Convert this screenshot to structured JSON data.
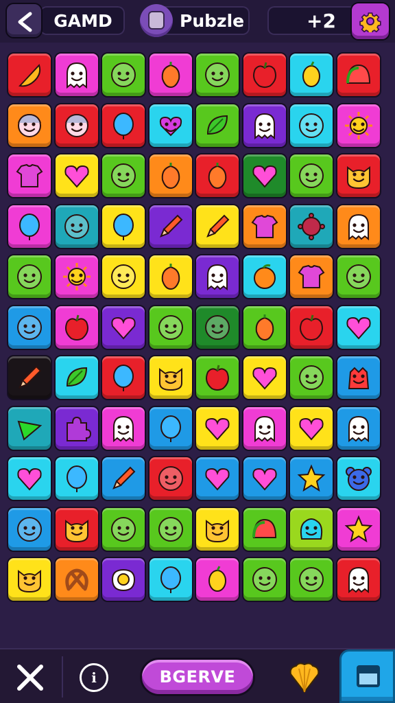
{
  "header": {
    "left_title": "GAMD",
    "mid_title": "Pubzle",
    "score": "+2"
  },
  "footer": {
    "main_button_label": "BGERVE",
    "info_label": "i"
  },
  "board": {
    "columns": 8,
    "rows": 11,
    "tiles": [
      [
        "red",
        "pizza"
      ],
      [
        "magenta",
        "ghost"
      ],
      [
        "green",
        "face"
      ],
      [
        "magenta",
        "pepper"
      ],
      [
        "green",
        "face"
      ],
      [
        "red",
        "apple"
      ],
      [
        "cyan",
        "lemon"
      ],
      [
        "red",
        "watermelon"
      ],
      [
        "orange",
        "doll"
      ],
      [
        "red",
        "doll"
      ],
      [
        "red",
        "balloon"
      ],
      [
        "cyan",
        "heart-blob"
      ],
      [
        "green",
        "leaf"
      ],
      [
        "purple",
        "ghost"
      ],
      [
        "cyan",
        "face"
      ],
      [
        "magenta",
        "sun"
      ],
      [
        "magenta",
        "shirt"
      ],
      [
        "yellow",
        "heart"
      ],
      [
        "green",
        "face"
      ],
      [
        "orange",
        "pepper"
      ],
      [
        "red",
        "pepper"
      ],
      [
        "darkgreen",
        "heart"
      ],
      [
        "green",
        "face"
      ],
      [
        "red",
        "cat"
      ],
      [
        "magenta",
        "balloon"
      ],
      [
        "teal",
        "face"
      ],
      [
        "yellow",
        "balloon"
      ],
      [
        "purple",
        "pencil"
      ],
      [
        "yellow",
        "pencil"
      ],
      [
        "orange",
        "shirt"
      ],
      [
        "teal",
        "virus"
      ],
      [
        "orange",
        "ghost"
      ],
      [
        "green",
        "face"
      ],
      [
        "magenta",
        "sun"
      ],
      [
        "yellow",
        "face"
      ],
      [
        "yellow",
        "pepper"
      ],
      [
        "purple",
        "ghost"
      ],
      [
        "cyan",
        "orange"
      ],
      [
        "orange",
        "shirt"
      ],
      [
        "green",
        "face"
      ],
      [
        "blue",
        "face"
      ],
      [
        "magenta",
        "apple"
      ],
      [
        "purple",
        "heart"
      ],
      [
        "green",
        "face"
      ],
      [
        "darkgreen",
        "face"
      ],
      [
        "green",
        "pepper"
      ],
      [
        "red",
        "apple"
      ],
      [
        "cyan",
        "heart"
      ],
      [
        "black",
        "pencil"
      ],
      [
        "cyan",
        "leaf"
      ],
      [
        "red",
        "balloon"
      ],
      [
        "yellow",
        "cat"
      ],
      [
        "green",
        "apple"
      ],
      [
        "yellow",
        "heart"
      ],
      [
        "green",
        "face"
      ],
      [
        "blue",
        "monster"
      ],
      [
        "teal",
        "arrow"
      ],
      [
        "purple",
        "puzzle"
      ],
      [
        "magenta",
        "ghost"
      ],
      [
        "blue",
        "balloon"
      ],
      [
        "yellow",
        "heart"
      ],
      [
        "magenta",
        "ghost"
      ],
      [
        "yellow",
        "heart"
      ],
      [
        "blue",
        "ghost"
      ],
      [
        "cyan",
        "heart"
      ],
      [
        "cyan",
        "balloon"
      ],
      [
        "blue",
        "pencil"
      ],
      [
        "red",
        "face"
      ],
      [
        "blue",
        "heart"
      ],
      [
        "blue",
        "heart"
      ],
      [
        "blue",
        "star"
      ],
      [
        "cyan",
        "bear"
      ],
      [
        "blue",
        "face"
      ],
      [
        "red",
        "cat"
      ],
      [
        "green",
        "face"
      ],
      [
        "green",
        "face"
      ],
      [
        "yellow",
        "cat"
      ],
      [
        "green",
        "watermelon"
      ],
      [
        "lime",
        "blob"
      ],
      [
        "magenta",
        "star"
      ],
      [
        "yellow",
        "cat"
      ],
      [
        "orange",
        "pretzel"
      ],
      [
        "purple",
        "egg"
      ],
      [
        "cyan",
        "balloon"
      ],
      [
        "magenta",
        "lemon"
      ],
      [
        "green",
        "face"
      ],
      [
        "green",
        "face"
      ],
      [
        "red",
        "ghost"
      ]
    ]
  },
  "colors": {
    "red": "#e8202a",
    "magenta": "#f03cd4",
    "green": "#58c81e",
    "darkgreen": "#1f8a2a",
    "orange": "#ff8a1a",
    "yellow": "#ffe21a",
    "cyan": "#2ad4ee",
    "blue": "#1f9ae6",
    "purple": "#7a2ad2",
    "teal": "#1fa8b8",
    "lime": "#9ad81e",
    "black": "#1a1418"
  }
}
